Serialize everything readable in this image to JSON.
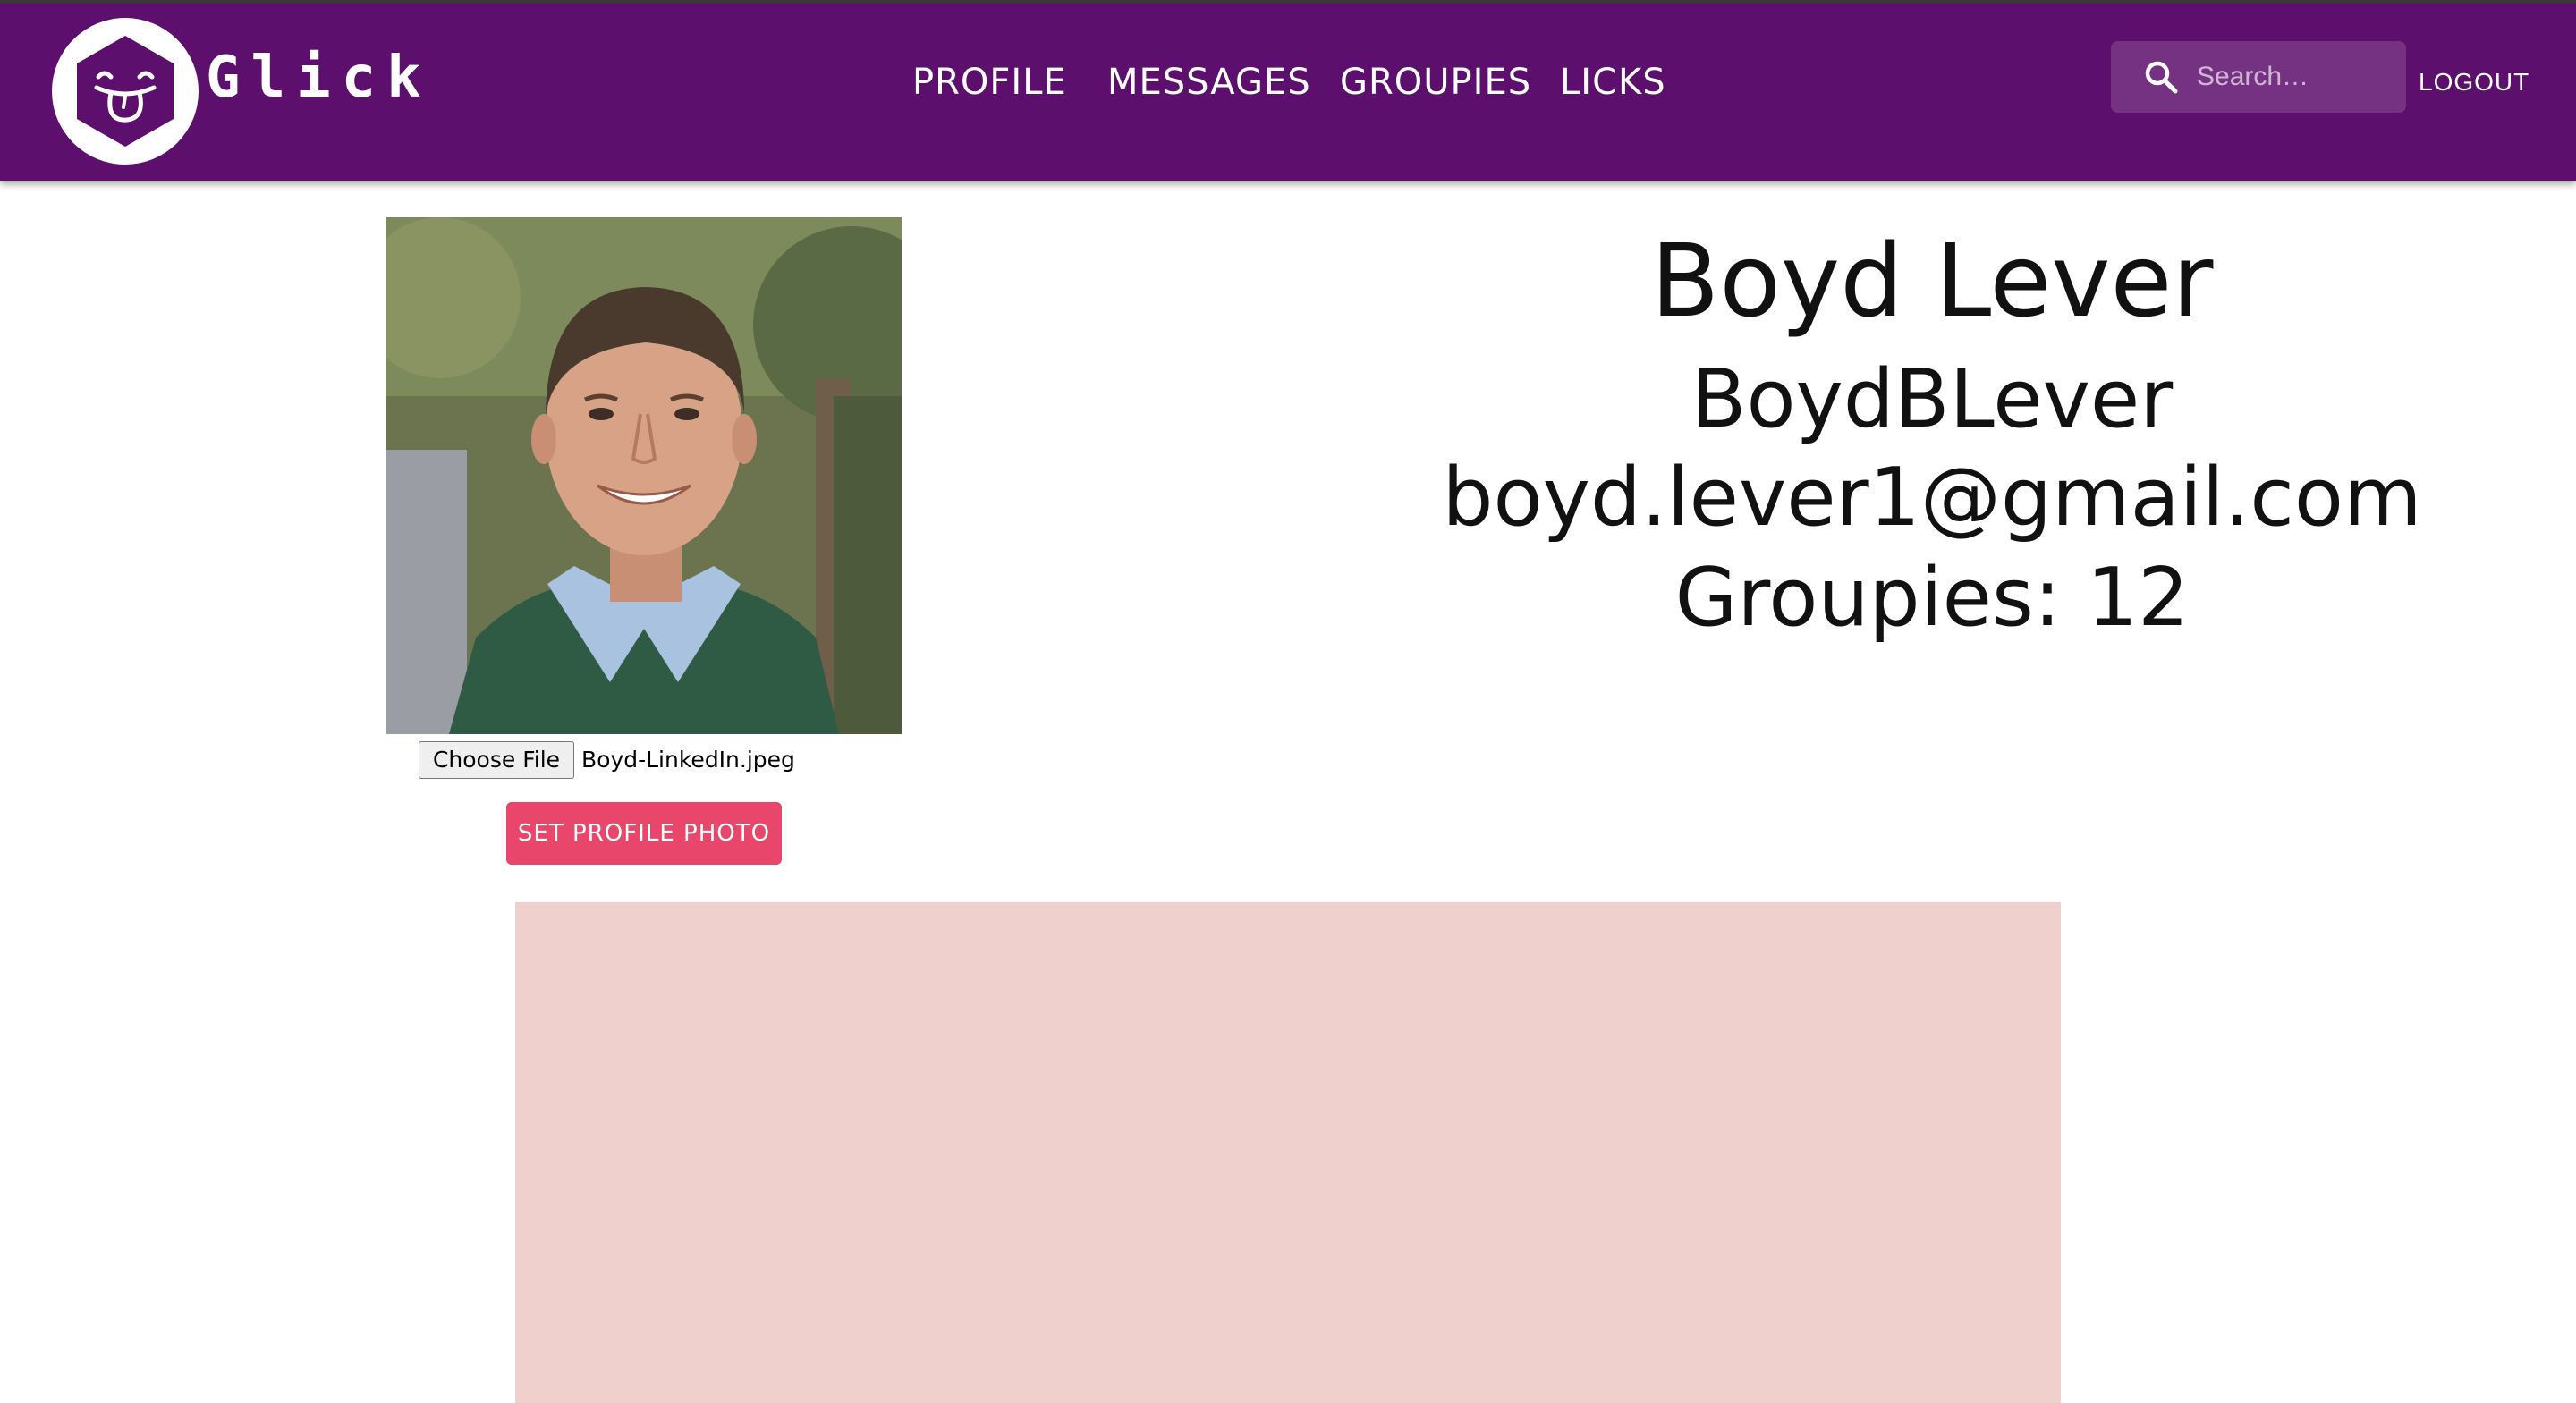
{
  "navbar": {
    "brand": "Glick",
    "logo_icon": "tongue-face-hexagon-icon",
    "items": [
      {
        "label": "PROFILE"
      },
      {
        "label": "MESSAGES"
      },
      {
        "label": "GROUPIES"
      },
      {
        "label": "LICKS"
      }
    ],
    "search": {
      "placeholder": "Search…",
      "value": "",
      "icon": "search-icon"
    },
    "logout_label": "LOGOUT"
  },
  "profile": {
    "photo_description_icon": "profile-photo",
    "file_input": {
      "button_label": "Choose File",
      "file_name": "Boyd-LinkedIn.jpeg"
    },
    "set_photo_label": "SET PROFILE PHOTO",
    "full_name": "Boyd Lever",
    "username": "BoydBLever",
    "email": "boyd.lever1@gmail.com",
    "groupies": "Groupies: 12"
  },
  "colors": {
    "navbar": "#5d0f6e",
    "accent_button": "#e8466b",
    "panel": "#f0d0cd"
  }
}
